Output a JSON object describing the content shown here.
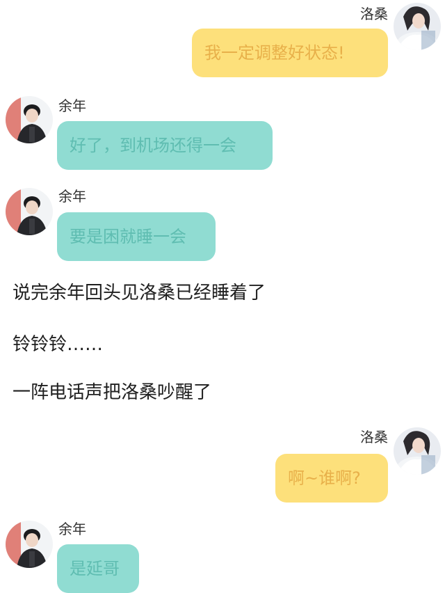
{
  "characters": {
    "luosang": {
      "name": "洛桑"
    },
    "yunian": {
      "name": "余年"
    }
  },
  "messages": [
    {
      "speaker": "洛桑",
      "text": "我一定调整好状态!"
    },
    {
      "speaker": "余年",
      "text": "好了，到机场还得一会"
    },
    {
      "speaker": "余年",
      "text": "要是困就睡一会"
    },
    {
      "speaker": "洛桑",
      "text": "啊~谁啊?"
    },
    {
      "speaker": "余年",
      "text": "是延哥"
    }
  ],
  "narration": [
    "说完余年回头见洛桑已经睡着了",
    "铃铃铃……",
    "一阵电话声把洛桑吵醒了"
  ],
  "colors": {
    "left_bubble_bg": "#90dcd2",
    "left_bubble_text": "#5fbdb1",
    "right_bubble_bg": "#fde07b",
    "right_bubble_text": "#e8b04a"
  },
  "icons": {
    "luosang_avatar": "girl-portrait-avatar",
    "yunian_avatar": "boy-portrait-avatar"
  }
}
